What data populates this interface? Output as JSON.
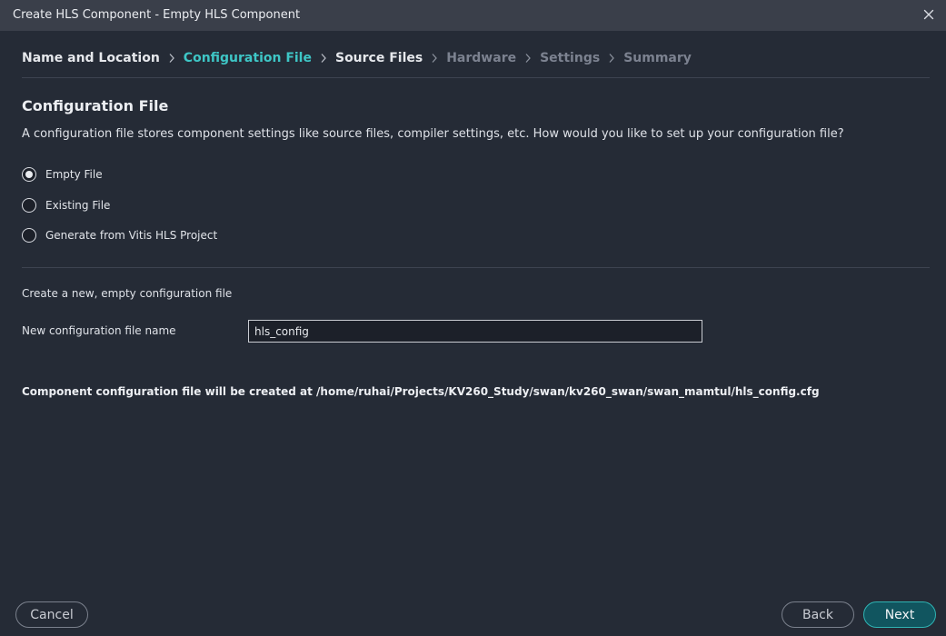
{
  "window": {
    "title": "Create HLS Component - Empty HLS Component",
    "close_icon": "close-icon"
  },
  "steps": [
    {
      "label": "Name and Location",
      "state": "done"
    },
    {
      "label": "Configuration File",
      "state": "active"
    },
    {
      "label": "Source Files",
      "state": "available"
    },
    {
      "label": "Hardware",
      "state": "disabled"
    },
    {
      "label": "Settings",
      "state": "disabled"
    },
    {
      "label": "Summary",
      "state": "disabled"
    }
  ],
  "section": {
    "title": "Configuration File",
    "description": "A configuration file stores component settings like source files, compiler settings, etc. How would you like to set up your configuration file?"
  },
  "options": {
    "selected": "Empty File",
    "items": [
      {
        "label": "Empty File",
        "checked": true
      },
      {
        "label": "Existing File",
        "checked": false
      },
      {
        "label": "Generate from Vitis HLS Project",
        "checked": false
      }
    ]
  },
  "detail": {
    "subtitle": "Create a new, empty configuration file",
    "field_label": "New configuration file name",
    "field_value": "hls_config",
    "path_note": "Component configuration file will be created at /home/ruhai/Projects/KV260_Study/swan/kv260_swan/swan_mamtul/hls_config.cfg"
  },
  "buttons": {
    "cancel": "Cancel",
    "back": "Back",
    "next": "Next"
  },
  "colors": {
    "background": "#252b36",
    "titlebar": "#3a3f4a",
    "accent": "#3ec6c6",
    "primary_button": "#11555f",
    "disabled_step": "#7c8290"
  }
}
